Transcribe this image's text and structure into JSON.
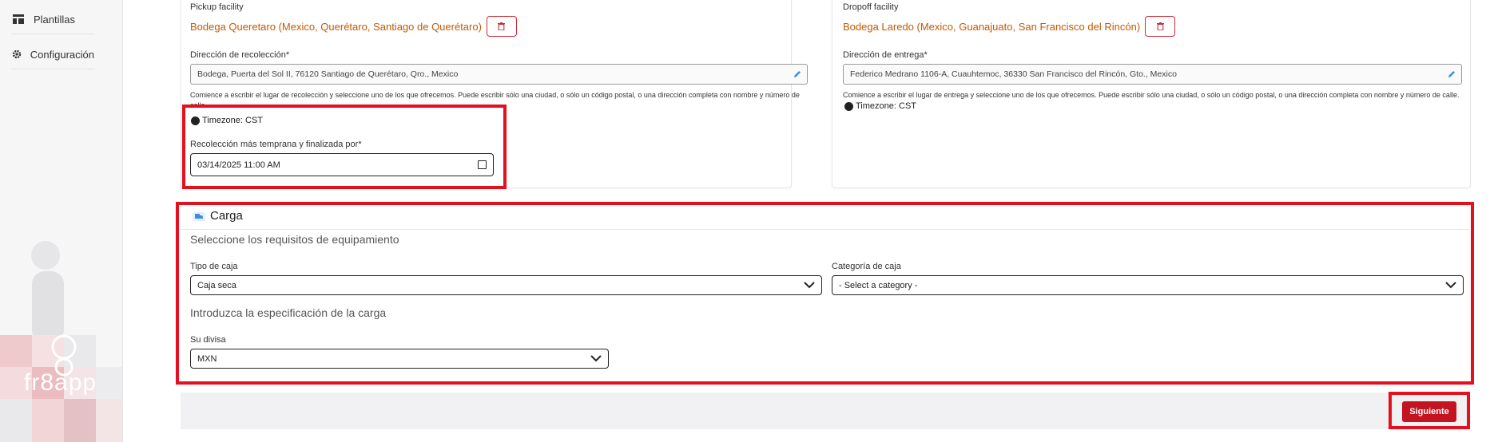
{
  "sidebar": {
    "items": [
      {
        "label": "Plantillas",
        "icon": "template-icon"
      },
      {
        "label": "Configuración",
        "icon": "gear-icon"
      }
    ],
    "logo_text": "fr8app"
  },
  "pickup": {
    "facility_label": "Pickup facility",
    "facility_name": "Bodega Queretaro (Mexico, Querétaro, Santiago de Querétaro)",
    "address_label": "Dirección de recolección*",
    "address_value": "Bodega, Puerta del Sol II, 76120 Santiago de Querétaro, Qro., Mexico",
    "help_text": "Comience a escribir el lugar de recolección y seleccione uno de los que ofrecemos. Puede escribir sólo una ciudad, o sólo un código postal, o una dirección completa con nombre y número de calle.",
    "timezone": "Timezone: CST",
    "datetime_label": "Recolección más temprana y finalizada por*",
    "datetime_value": "03/14/2025 11:00 AM"
  },
  "dropoff": {
    "facility_label": "Dropoff facility",
    "facility_name": "Bodega Laredo (Mexico, Guanajuato, San Francisco del Rincón)",
    "address_label": "Dirección de entrega*",
    "address_value": "Federico Medrano 1106-A, Cuauhtemoc, 36330 San Francisco del Rincón, Gto., Mexico",
    "help_text": "Comience a escribir el lugar de entrega y seleccione uno de los que ofrecemos. Puede escribir sólo una ciudad, o sólo un código postal, o una dirección completa con nombre y número de calle.",
    "timezone": "Timezone: CST"
  },
  "carga": {
    "title": "Carga",
    "equipment_heading": "Seleccione los requisitos de equipamiento",
    "box_type_label": "Tipo de caja",
    "box_type_value": "Caja seca",
    "box_category_label": "Categoría de caja",
    "box_category_value": "- Select a category -",
    "spec_heading": "Introduzca la especificación de la carga",
    "currency_label": "Su divisa",
    "currency_value": "MXN"
  },
  "footer": {
    "next_label": "Siguiente"
  },
  "colors": {
    "accent_red": "#c3141f",
    "highlight_red": "#e4101e",
    "facility_orange": "#c25a06",
    "icon_blue": "#3a8ee6"
  }
}
